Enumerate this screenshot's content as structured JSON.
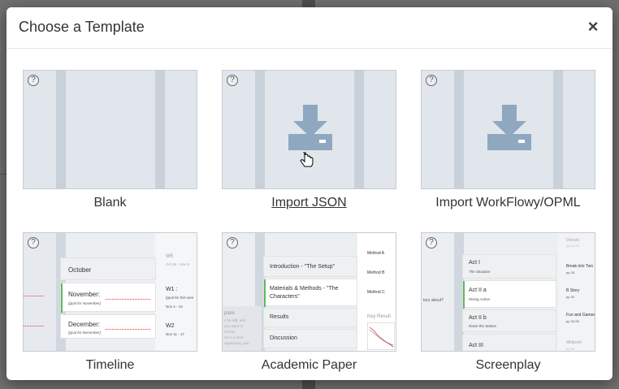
{
  "modal": {
    "title": "Choose a Template",
    "close_label": "×"
  },
  "templates": [
    {
      "label": "Blank",
      "icon": "blank-template-icon"
    },
    {
      "label": "Import JSON",
      "icon": "download-icon"
    },
    {
      "label": "Import WorkFlowy/OPML",
      "icon": "download-icon"
    },
    {
      "label": "Timeline",
      "icon": "timeline-preview"
    },
    {
      "label": "Academic Paper",
      "icon": "academic-paper-preview"
    },
    {
      "label": "Screenplay",
      "icon": "screenplay-preview"
    }
  ],
  "help_label": "?",
  "timeline_preview": {
    "card1": "October",
    "card2": "November:",
    "card2_sub": "(goal for November)",
    "card3": "December:",
    "card3_sub": "(goal for December)",
    "right_w5": "W5",
    "right_w5_sub": "Oct 06 - Nov 8",
    "right_w1": "W1 :",
    "right_w1_sub": "(goal for this wee",
    "right_w1_date": "Nov 4 - 10",
    "right_w2": "W2",
    "right_w2_date": "Nov 11 - 17"
  },
  "academic_preview": {
    "item1": "Introduction - \"The Setup\"",
    "item2": "Materials & Methods - \"The Characters\"",
    "item3": "Results",
    "item4": "Discussion",
    "right1": "Method A",
    "right2": "Method B",
    "right3": "Method C",
    "right4": "Key Result",
    "left_heading": "plate",
    "left_sub1": "n for left, and",
    "left_sub2": "you want to",
    "left_sub3": "ut it by",
    "left_sub4": "ne in a time",
    "left_sub5": "organizing, you"
  },
  "screenplay_preview": {
    "act1": "Act I",
    "act1_sub": "The Situation",
    "act2a": "Act II a",
    "act2a_sub": "Rising Action",
    "act2b": "Act II b",
    "act2b_sub": "Raise the Stakes",
    "act3": "Act III",
    "left_text": "tory about?",
    "right1": "Debate",
    "right1_sub": "pp 12-25",
    "right2": "Break into Two",
    "right2_sub": "pp 25",
    "right3": "B Story",
    "right3_sub": "pp 30",
    "right4": "Fun and Games",
    "right4_sub": "pp 30-55",
    "right5": "Midpoint",
    "right5_sub": "pp 55"
  },
  "colors": {
    "thumb_bg": "#e0e6ec",
    "stripe": "#c8d1da",
    "icon": "#8fa8c0",
    "active_bar": "#5fb85f"
  }
}
